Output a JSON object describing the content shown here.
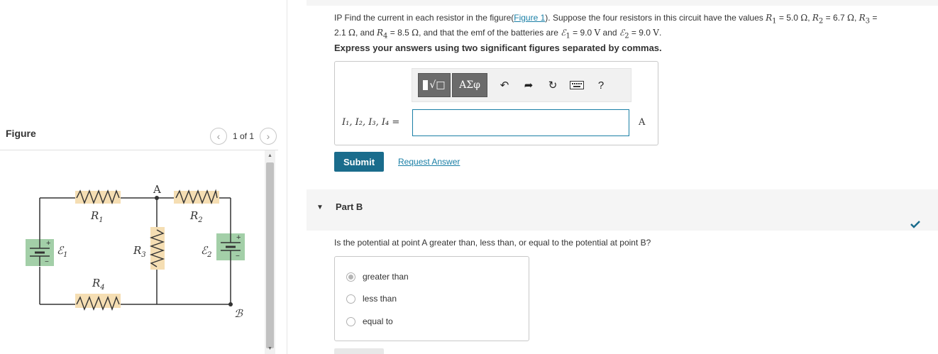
{
  "figure": {
    "title": "Figure",
    "pager": "1 of 1",
    "circuit": {
      "r1": "R",
      "r1_sub": "1",
      "r2": "R",
      "r2_sub": "2",
      "r3": "R",
      "r3_sub": "3",
      "r4": "R",
      "r4_sub": "4",
      "e1": "ℰ",
      "e1_sub": "1",
      "e2": "ℰ",
      "e2_sub": "2",
      "point_a": "A",
      "point_b": "ℬ",
      "plus": "+",
      "minus": "−",
      "battery_color": "#a3cfa8",
      "resistor_color": "#f5deb3"
    }
  },
  "partA": {
    "q_prefix": "IP Find the current in each resistor in the figure(",
    "q_link": "Figure 1",
    "q_mid": "). Suppose the four resistors in this circuit have the values ",
    "r1": "R",
    "r1_sub": "1",
    "r1_val": " = 5.0 ",
    "ohm": "Ω",
    "r2": "R",
    "r2_sub": "2",
    "r2_val": " = 6.7 ",
    "r3": "R",
    "r3_sub": "3",
    "r3_val": " =",
    "line2_r3val": "2.1 ",
    "and1": ", and ",
    "r4": "R",
    "r4_sub": "4",
    "r4_val": " = 8.5 ",
    "emf_text": ", and that the emf of the batteries are ",
    "e1": "ℰ",
    "e1_sub": "1",
    "e1_val": " = 9.0 ",
    "volt": "V",
    "and2": " and ",
    "e2": "ℰ",
    "e2_sub": "2",
    "e2_val": " = 9.0 ",
    "period": ".",
    "instruction": "Express your answers using two significant figures separated by commas.",
    "toolbar": {
      "templates_label": "√□",
      "greek_label": "ΑΣφ",
      "undo_icon": "undo-icon",
      "redo_icon": "redo-icon",
      "reset_icon": "reset-icon",
      "keyboard_icon": "keyboard-icon",
      "help_label": "?"
    },
    "equation_label": "I₁, I₂, I₃, I₄ =",
    "input_value": "",
    "unit": "A",
    "submit_label": "Submit",
    "request_label": "Request Answer"
  },
  "partB": {
    "title": "Part B",
    "question": "Is the potential at point A greater than, less than, or equal to the potential at point B?",
    "options": [
      "greater than",
      "less than",
      "equal to"
    ],
    "selected_index": 0,
    "check_color": "#1a6c8c"
  }
}
